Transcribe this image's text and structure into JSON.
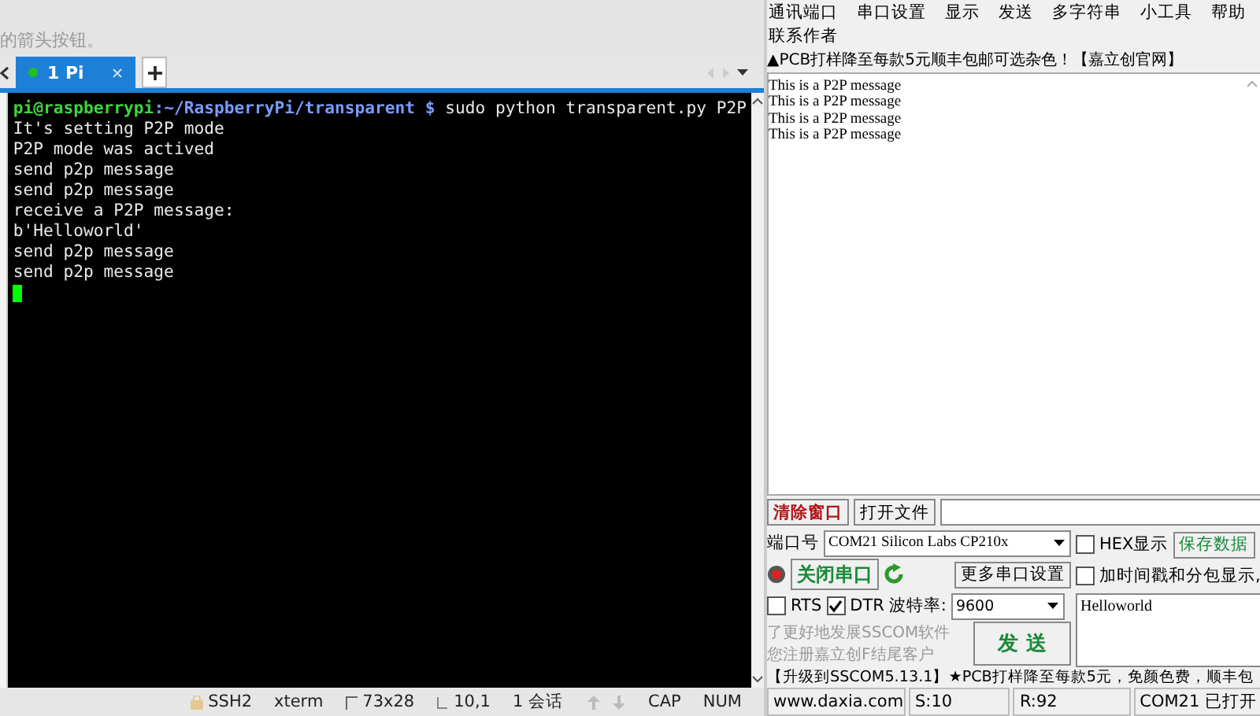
{
  "background_window": {
    "hint_text": "的箭头按钮。"
  },
  "terminal": {
    "tabs": [
      {
        "label": "1 Pi",
        "selected": true,
        "connected": true
      }
    ],
    "lines": [
      {
        "segments": [
          {
            "kind": "user",
            "text": "pi@raspberrypi"
          },
          {
            "kind": "path",
            "text": ":~/RaspberryPi/transparent $"
          },
          {
            "kind": "plain",
            "text": " sudo python transparent.py P2P"
          }
        ]
      },
      {
        "segments": [
          {
            "kind": "plain",
            "text": "It's setting P2P mode"
          }
        ]
      },
      {
        "segments": [
          {
            "kind": "plain",
            "text": "P2P mode was actived"
          }
        ]
      },
      {
        "segments": [
          {
            "kind": "plain",
            "text": "send p2p message"
          }
        ]
      },
      {
        "segments": [
          {
            "kind": "plain",
            "text": "send p2p message"
          }
        ]
      },
      {
        "segments": [
          {
            "kind": "plain",
            "text": "receive a P2P message:"
          }
        ]
      },
      {
        "segments": [
          {
            "kind": "plain",
            "text": "b'Helloworld'"
          }
        ]
      },
      {
        "segments": [
          {
            "kind": "plain",
            "text": "send p2p message"
          }
        ]
      },
      {
        "segments": [
          {
            "kind": "plain",
            "text": "send p2p message"
          }
        ]
      }
    ],
    "status_bar": [
      {
        "kind": "lock",
        "text": "SSH2"
      },
      {
        "kind": "plain",
        "text": "xterm"
      },
      {
        "kind": "size",
        "text": "73x28"
      },
      {
        "kind": "cursor",
        "text": "10,1"
      },
      {
        "kind": "plain",
        "text": "1 会话"
      },
      {
        "kind": "arrows"
      },
      {
        "kind": "plain",
        "text": "CAP"
      },
      {
        "kind": "plain",
        "text": "NUM"
      }
    ]
  },
  "serial": {
    "menu": [
      "通讯端口",
      "串口设置",
      "显示",
      "发送",
      "多字符串",
      "小工具",
      "帮助"
    ],
    "menu_row2": [
      "联系作者"
    ],
    "ad": "▲PCB打样降至每款5元顺丰包邮可选杂色！【嘉立创官网】",
    "received": [
      "This is a P2P message",
      "This is a P2P message",
      "This is a P2P message",
      "This is a P2P message"
    ],
    "clear_button": "清除窗口",
    "open_file_button": "打开文件",
    "port_label": "端口号",
    "port_value": "COM21 Silicon Labs CP210x",
    "port_open": true,
    "hex_display": {
      "label": "HEX显示",
      "checked": false
    },
    "save_button": "保存数据",
    "close_port_button": "关闭串口",
    "more_settings_button": "更多串口设置",
    "timestamp": {
      "label": "加时间戳和分包显示,",
      "checked": false
    },
    "rts": {
      "label": "RTS",
      "checked": false
    },
    "dtr": {
      "label": "DTR",
      "checked": true
    },
    "baud_label": "波特率:",
    "baud_value": "9600",
    "send_text": "Helloworld",
    "notice": [
      "了更好地发展SSCOM软件",
      "您注册嘉立创F结尾客户"
    ],
    "send_button": "发 送",
    "promo": "【升级到SSCOM5.13.1】★PCB打样降至每款5元，免颜色费，顺丰包",
    "status_bar": [
      "www.daxia.com",
      "S:10",
      "R:92",
      "COM21 已打开"
    ]
  }
}
